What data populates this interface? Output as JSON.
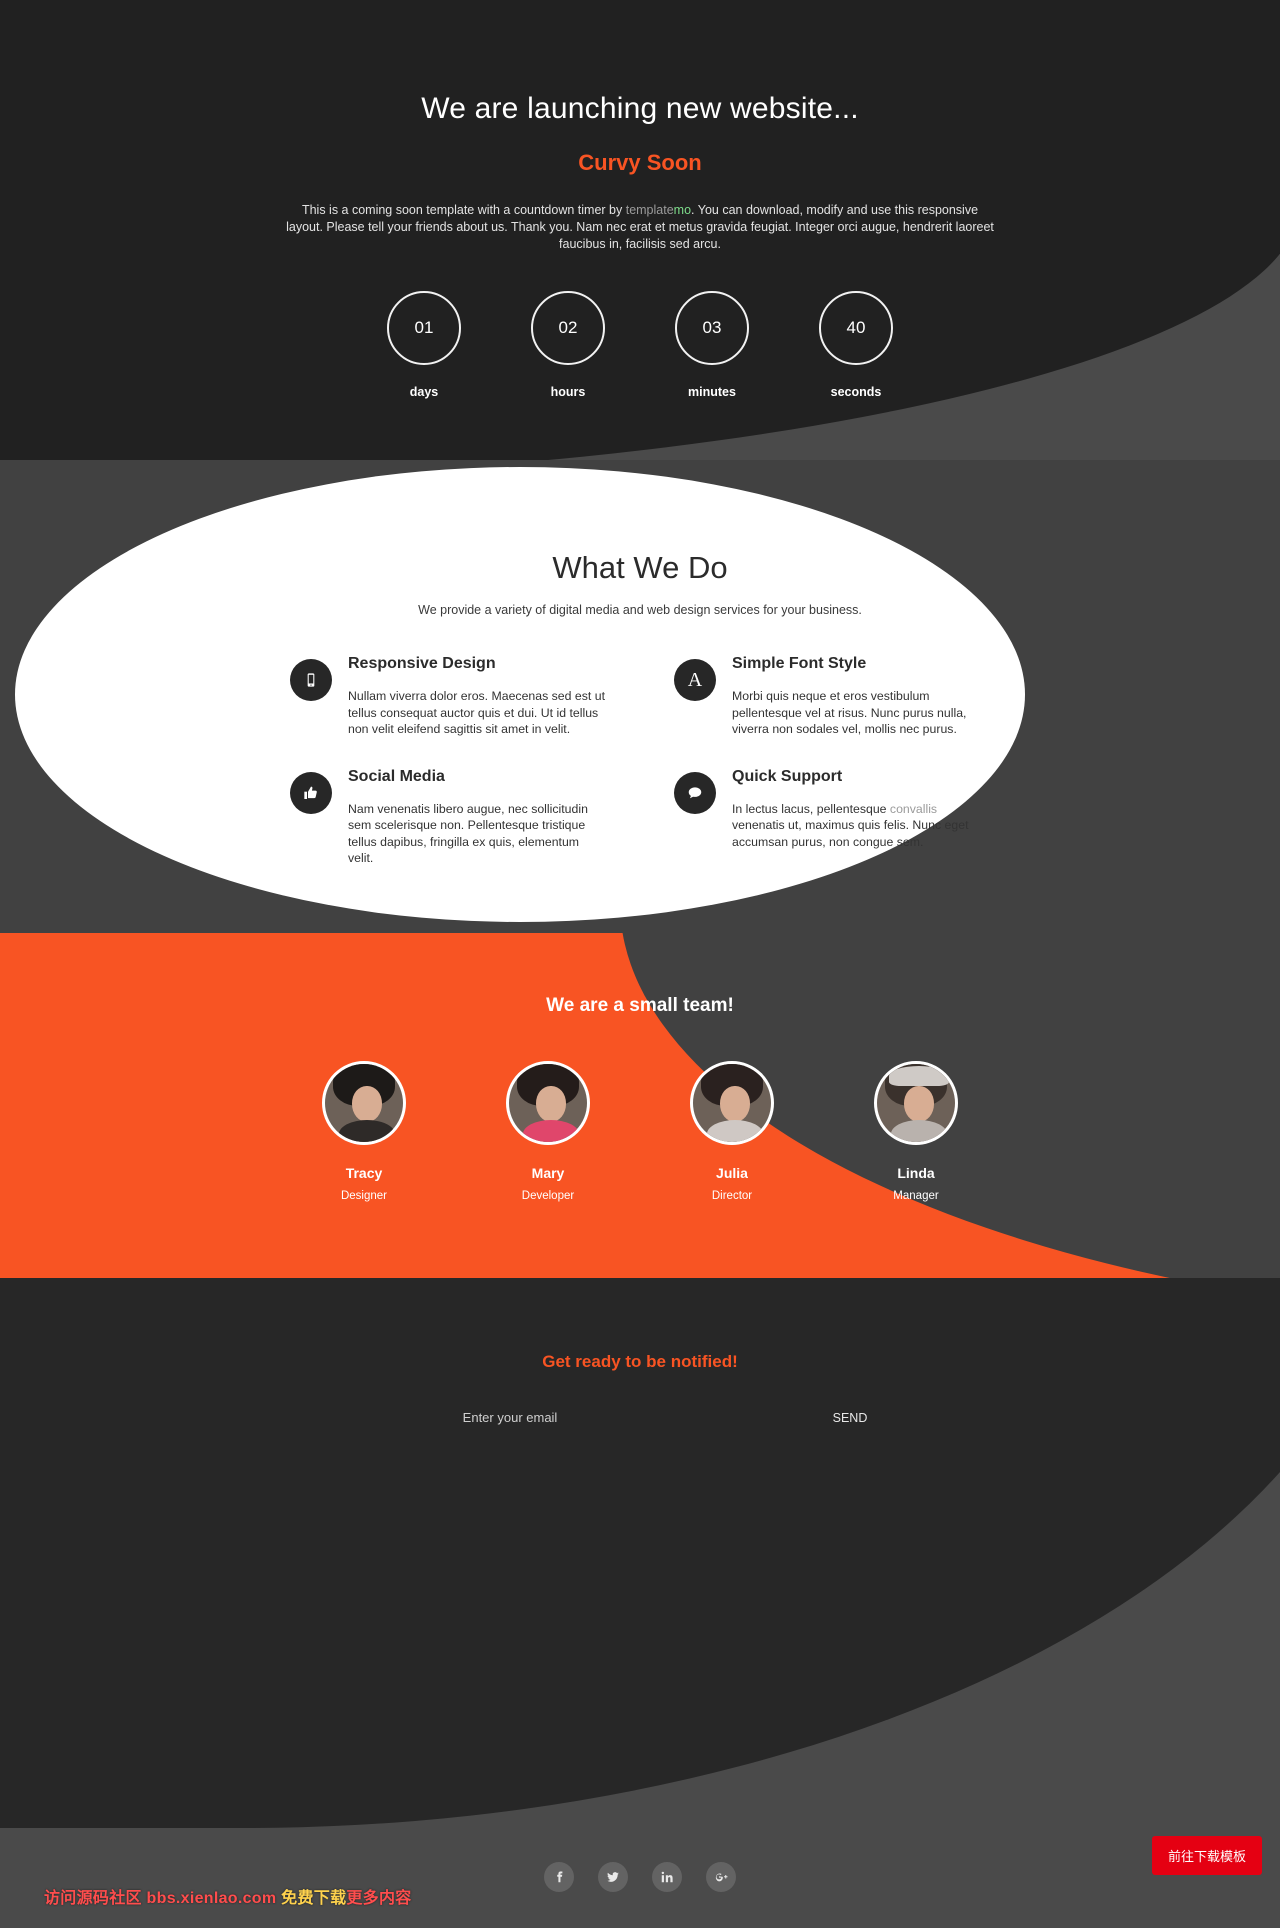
{
  "hero": {
    "title": "We are launching new website...",
    "subtitle": "Curvy Soon",
    "paragraph_part1": "This is a coming soon template with a countdown timer by ",
    "brand_a": "template",
    "brand_b": "mo",
    "paragraph_part2": ". You can download, modify and use this responsive layout. Please tell your friends about us. Thank you. Nam nec erat et metus gravida feugiat. Integer orci augue, hendrerit laoreet faucibus in, facilisis sed arcu.",
    "countdown": [
      {
        "value": "01",
        "label": "days"
      },
      {
        "value": "02",
        "label": "hours"
      },
      {
        "value": "03",
        "label": "minutes"
      },
      {
        "value": "40",
        "label": "seconds"
      }
    ]
  },
  "services": {
    "title": "What We Do",
    "subtitle": "We provide a variety of digital media and web design services for your business.",
    "features": [
      {
        "icon": "mobile-icon",
        "title": "Responsive Design",
        "text": "Nullam viverra dolor eros. Maecenas sed est ut tellus consequat auctor quis et dui. Ut id tellus non velit eleifend sagittis sit amet in velit."
      },
      {
        "icon": "font-a-icon",
        "title": "Simple Font Style",
        "text": "Morbi quis neque et eros vestibulum pellentesque vel at risus. Nunc purus nulla, viverra non sodales vel, mollis nec purus."
      },
      {
        "icon": "thumbs-up-icon",
        "title": "Social Media",
        "text": "Nam venenatis libero augue, nec sollicitudin sem scelerisque non. Pellentesque tristique tellus dapibus, fringilla ex quis, elementum velit."
      },
      {
        "icon": "speech-bubble-icon",
        "title": "Quick Support",
        "text_pre": "In lectus lacus, pellentesque ",
        "link": "convallis",
        "text_post": " venenatis ut, maximus quis felis. Nunc eget accumsan purus, non congue sem."
      }
    ]
  },
  "team": {
    "title": "We are a small team!",
    "members": [
      {
        "name": "Tracy",
        "role": "Designer"
      },
      {
        "name": "Mary",
        "role": "Developer"
      },
      {
        "name": "Julia",
        "role": "Director"
      },
      {
        "name": "Linda",
        "role": "Manager"
      }
    ]
  },
  "footer": {
    "notify_title": "Get ready to be notified!",
    "email_placeholder": "Enter your email",
    "email_value": "",
    "send_label": "SEND",
    "socials": [
      {
        "name": "facebook-icon",
        "glyph": "f"
      },
      {
        "name": "twitter-icon",
        "glyph": "t"
      },
      {
        "name": "linkedin-icon",
        "glyph": "in"
      },
      {
        "name": "google-plus-icon",
        "glyph": "g+"
      }
    ]
  },
  "overlay": {
    "download_label": "前往下载模板",
    "watermark_1": "访问源码社区 bbs.xienlao.com ",
    "watermark_2": "免费下载",
    "watermark_3": "更多内容"
  },
  "colors": {
    "accent": "#f85423",
    "dark": "#212121",
    "mid_dark": "#414141",
    "download_red": "#e50012"
  }
}
